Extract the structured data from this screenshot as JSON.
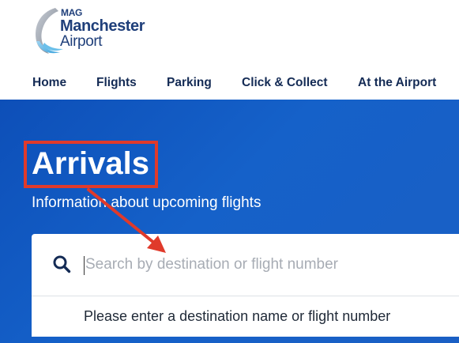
{
  "brand": {
    "mag": "MAG",
    "name_line1": "Manchester",
    "name_line2": "Airport"
  },
  "nav": {
    "items": [
      {
        "label": "Home"
      },
      {
        "label": "Flights"
      },
      {
        "label": "Parking"
      },
      {
        "label": "Click & Collect"
      },
      {
        "label": "At the Airport"
      }
    ]
  },
  "hero": {
    "title": "Arrivals",
    "subtitle": "Information about upcoming flights"
  },
  "search": {
    "icon": "search-icon",
    "value": "",
    "placeholder": "Search by destination or flight number",
    "suggestion": "Please enter a destination name or flight number"
  },
  "colors": {
    "navy": "#142b55",
    "hero_blue": "#1561c9",
    "annotation_red": "#e03a2b"
  }
}
